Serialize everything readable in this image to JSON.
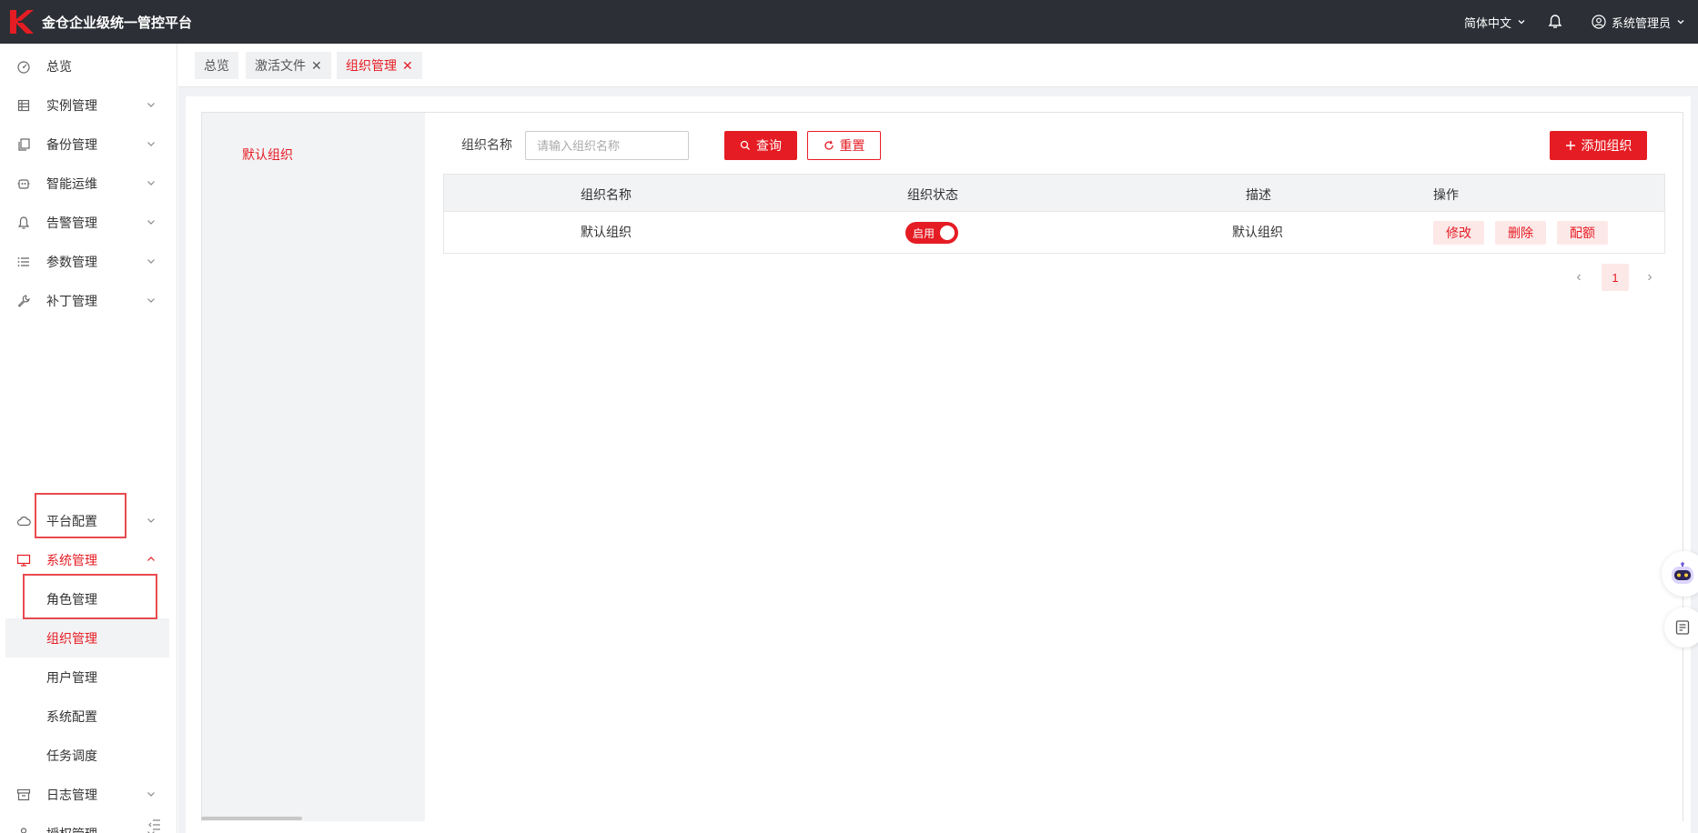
{
  "app": {
    "title": "金仓企业级统一管控平台"
  },
  "header": {
    "language": "简体中文",
    "user": "系统管理员"
  },
  "sidebar": {
    "items": [
      {
        "label": "总览",
        "icon": "dashboard-icon"
      },
      {
        "label": "实例管理",
        "icon": "database-icon"
      },
      {
        "label": "备份管理",
        "icon": "copy-icon"
      },
      {
        "label": "智能运维",
        "icon": "robot-icon"
      },
      {
        "label": "告警管理",
        "icon": "bell-icon"
      },
      {
        "label": "参数管理",
        "icon": "list-icon"
      },
      {
        "label": "补丁管理",
        "icon": "wrench-icon"
      },
      {
        "label": "平台配置",
        "icon": "cloud-icon"
      },
      {
        "label": "系统管理",
        "icon": "monitor-icon"
      },
      {
        "label": "日志管理",
        "icon": "archive-icon"
      },
      {
        "label": "授权管理",
        "icon": "stamp-icon"
      }
    ],
    "system_subitems": [
      {
        "label": "角色管理"
      },
      {
        "label": "组织管理"
      },
      {
        "label": "用户管理"
      },
      {
        "label": "系统配置"
      },
      {
        "label": "任务调度"
      }
    ]
  },
  "tabs": [
    {
      "label": "总览"
    },
    {
      "label": "激活文件"
    },
    {
      "label": "组织管理"
    }
  ],
  "tree": {
    "root": "默认组织"
  },
  "filter": {
    "label": "组织名称",
    "placeholder": "请输入组织名称",
    "query_label": "查询",
    "reset_label": "重置",
    "add_label": "添加组织"
  },
  "table": {
    "columns": [
      "组织名称",
      "组织状态",
      "描述",
      "操作"
    ],
    "rows": [
      {
        "name": "默认组织",
        "status": "启用",
        "description": "默认组织",
        "actions": [
          "修改",
          "删除",
          "配额"
        ]
      }
    ]
  },
  "pagination": {
    "current": "1"
  },
  "colors": {
    "accent": "#e51c23",
    "topbar": "#2c2f36"
  }
}
